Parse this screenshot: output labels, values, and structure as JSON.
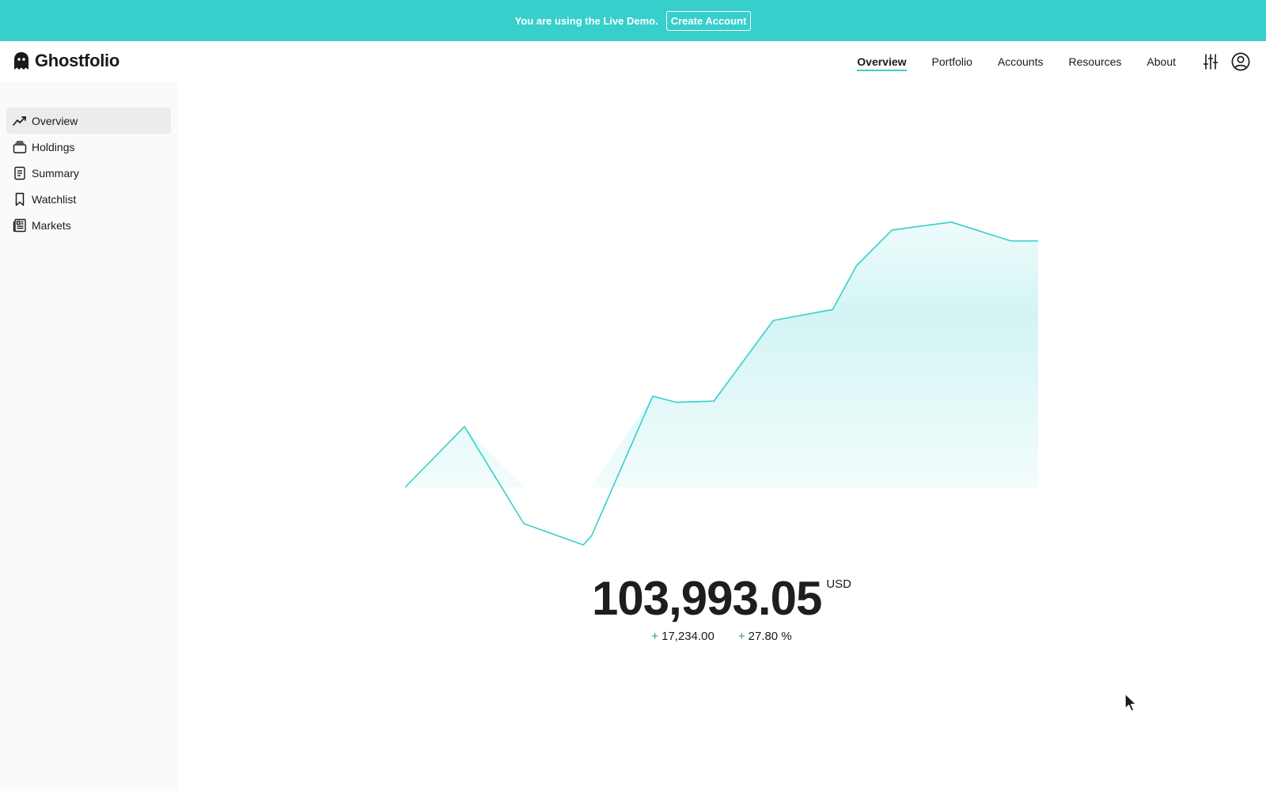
{
  "banner": {
    "message": "You are using the Live Demo.",
    "button_label": "Create Account",
    "color": "#36cfcc"
  },
  "header": {
    "app_name": "Ghostfolio",
    "nav": [
      {
        "label": "Overview",
        "active": true
      },
      {
        "label": "Portfolio",
        "active": false
      },
      {
        "label": "Accounts",
        "active": false
      },
      {
        "label": "Resources",
        "active": false
      },
      {
        "label": "About",
        "active": false
      }
    ],
    "icons": [
      "settings-sliders-icon",
      "user-account-icon"
    ]
  },
  "sidebar": {
    "items": [
      {
        "label": "Overview",
        "icon": "trend-line-icon",
        "active": true
      },
      {
        "label": "Holdings",
        "icon": "layers-icon",
        "active": false
      },
      {
        "label": "Summary",
        "icon": "document-icon",
        "active": false
      },
      {
        "label": "Watchlist",
        "icon": "bookmark-icon",
        "active": false
      },
      {
        "label": "Markets",
        "icon": "newspaper-icon",
        "active": false
      }
    ]
  },
  "summary": {
    "total_value": "103,993.05",
    "currency": "USD",
    "absolute_change": "17,234.00",
    "relative_change": "27.80 %",
    "positive_color": "#2e9e56"
  },
  "chart_data": {
    "type": "area",
    "accent_color": "#36cfcc",
    "baseline": 0,
    "values": [
      0,
      10,
      -6,
      -9.5,
      -8,
      15,
      14,
      14.2,
      27.5,
      29.3,
      36.5,
      42.4,
      43.7,
      40.6,
      40.6
    ],
    "step": [
      0,
      1,
      2,
      3,
      3.14,
      4.17,
      4.57,
      5.2,
      6.2,
      7.2,
      7.6,
      8.2,
      9.2,
      10.2,
      10.66
    ],
    "grid": false,
    "axes_visible": false
  }
}
